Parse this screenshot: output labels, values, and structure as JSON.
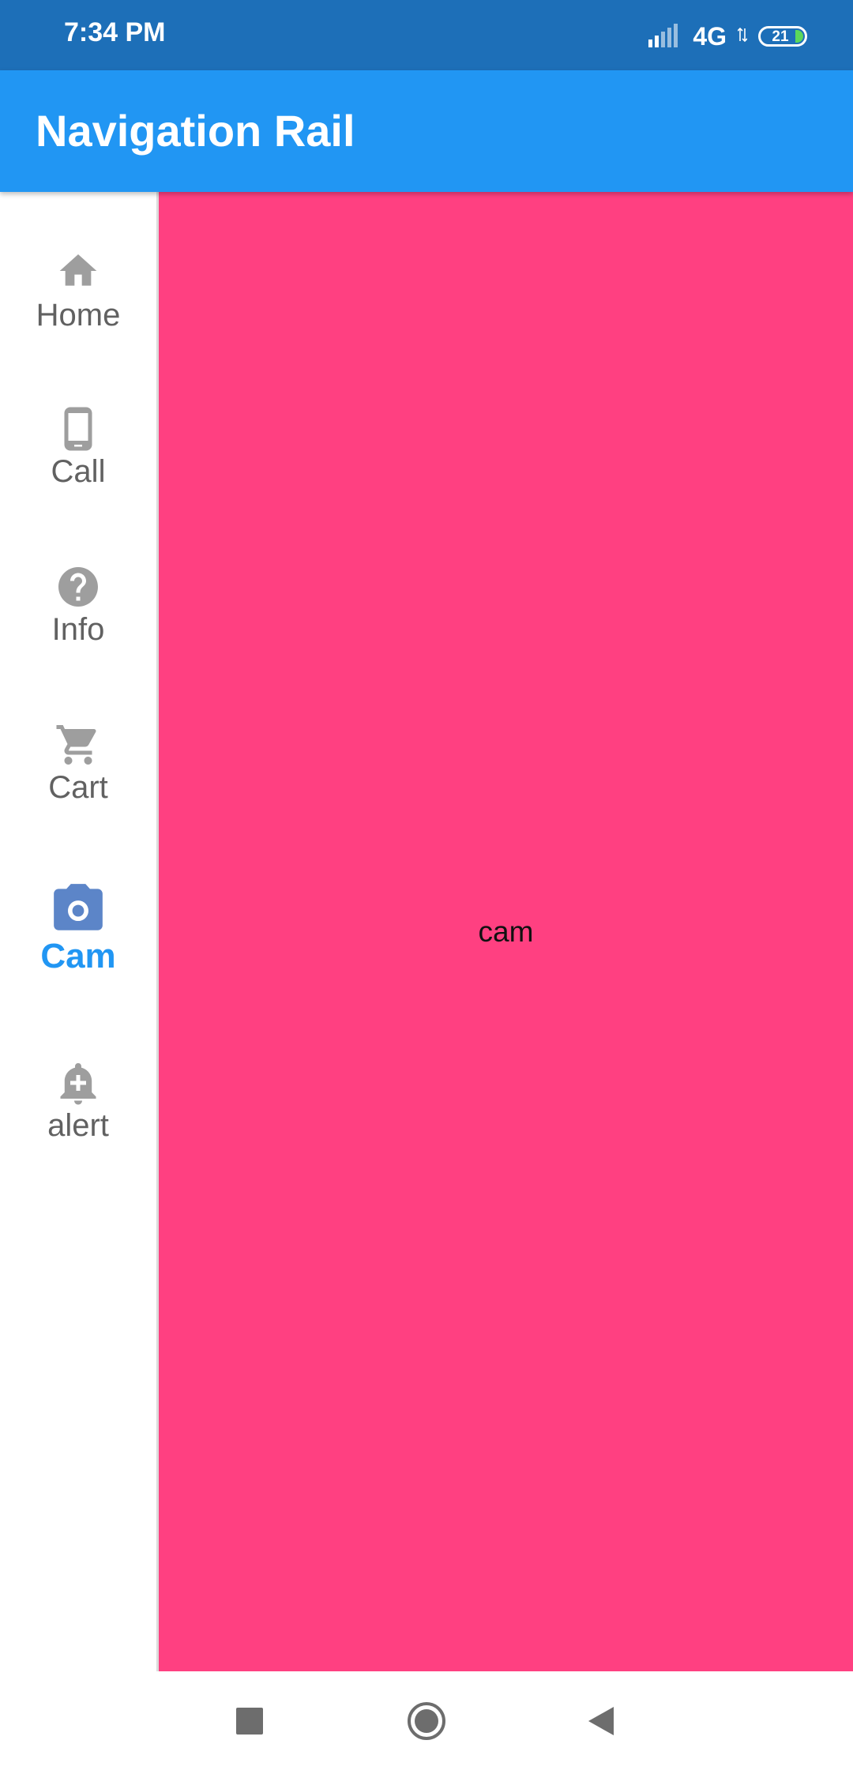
{
  "status_bar": {
    "time": "7:34 PM",
    "network": "4G",
    "battery": "21",
    "battery_color": "#5bd85b"
  },
  "app_bar": {
    "title": "Navigation Rail",
    "color": "#2196f3"
  },
  "nav_rail": {
    "selected_index": 4,
    "selected_color": "#2196f3",
    "items": [
      {
        "label": "Home",
        "icon": "home-icon"
      },
      {
        "label": "Call",
        "icon": "phone-icon"
      },
      {
        "label": "Info",
        "icon": "help-icon"
      },
      {
        "label": "Cart",
        "icon": "cart-icon"
      },
      {
        "label": "Cam",
        "icon": "camera-icon"
      },
      {
        "label": "alert",
        "icon": "add-alert-icon"
      }
    ]
  },
  "content": {
    "text": "cam",
    "background": "#ff4081"
  },
  "system_nav": {
    "buttons": [
      "recents-icon",
      "home-circle-icon",
      "back-icon"
    ]
  }
}
